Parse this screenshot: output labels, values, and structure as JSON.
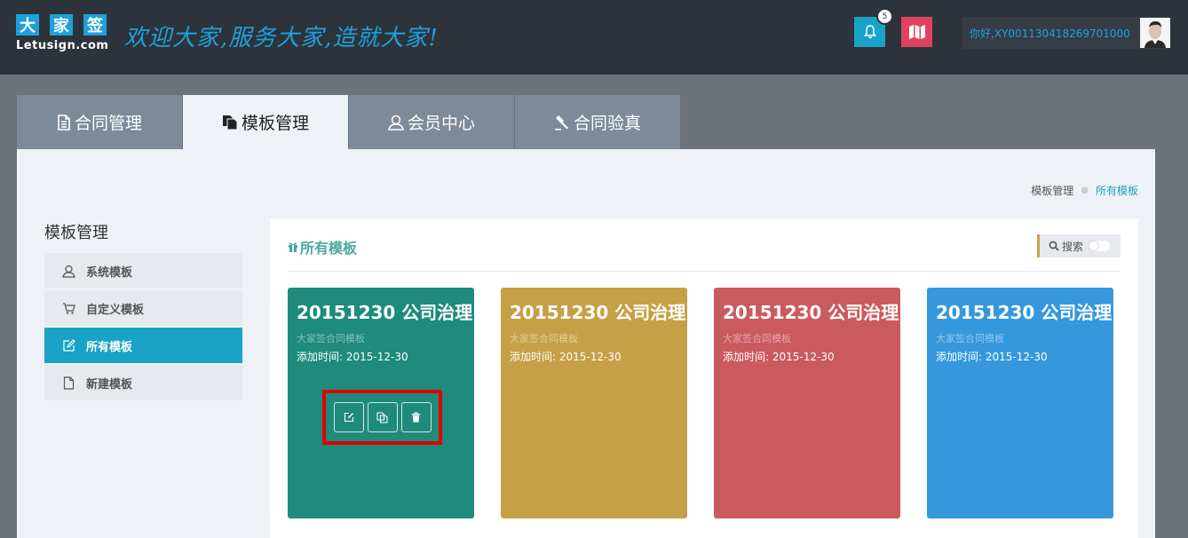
{
  "header": {
    "logo_chars": [
      "大",
      "家",
      "签"
    ],
    "logo_text": "Letusign.com",
    "slogan": "欢迎大家,服务大家,造就大家!",
    "notification_count": "5",
    "user_greeting": "你好,XY001130418269701000"
  },
  "tabs": [
    {
      "label": "合同管理",
      "icon": "document-icon",
      "active": false
    },
    {
      "label": "模板管理",
      "icon": "copy-icon",
      "active": true
    },
    {
      "label": "会员中心",
      "icon": "user-icon",
      "active": false
    },
    {
      "label": "合同验真",
      "icon": "gavel-icon",
      "active": false
    }
  ],
  "breadcrumb": {
    "parent": "模板管理",
    "current": "所有模板"
  },
  "sidebar": {
    "title": "模板管理",
    "items": [
      {
        "label": "系统模板",
        "icon": "user-icon",
        "active": false
      },
      {
        "label": "自定义模板",
        "icon": "cart-icon",
        "active": false
      },
      {
        "label": "所有模板",
        "icon": "edit-icon",
        "active": true
      },
      {
        "label": "新建模板",
        "icon": "file-icon",
        "active": false
      }
    ]
  },
  "panel": {
    "title": "所有模板",
    "search_label": "搜索"
  },
  "cards": [
    {
      "title": "20151230 公司治理",
      "subtitle": "大家签合同模板",
      "date": "添加时间: 2015-12-30",
      "color": "#1e8b7c"
    },
    {
      "title": "20151230 公司治理",
      "subtitle": "大家签合同模板",
      "date": "添加时间: 2015-12-30",
      "color": "#c6a046"
    },
    {
      "title": "20151230 公司治理",
      "subtitle": "大家签合同模板",
      "date": "添加时间: 2015-12-30",
      "color": "#cb5a5e"
    },
    {
      "title": "20151230 公司治理",
      "subtitle": "大家签合同模板",
      "date": "添加时间: 2015-12-30",
      "color": "#3598dc"
    }
  ],
  "colors": {
    "header_bg": "#2d333b",
    "accent": "#1aa3c8",
    "map_button": "#e0435c",
    "highlight_border": "#e00000"
  }
}
